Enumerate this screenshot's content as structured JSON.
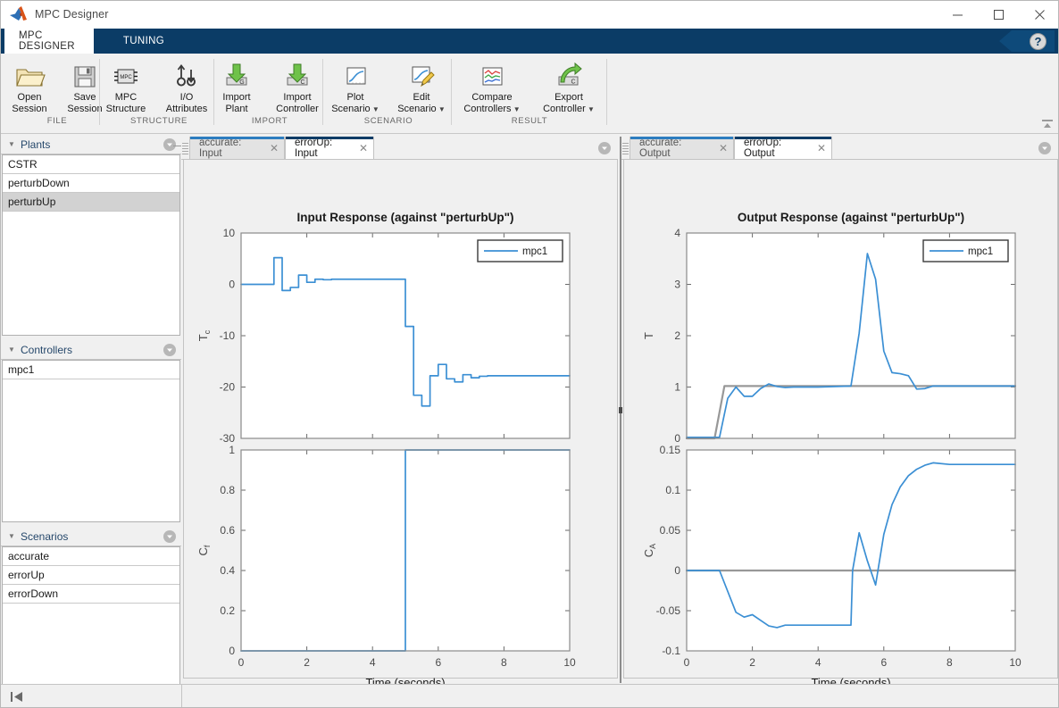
{
  "window": {
    "title": "MPC Designer",
    "minimize_label": "—",
    "maximize_label": "□",
    "close_label": "✕"
  },
  "ribbon": {
    "tabs": [
      {
        "label": "MPC DESIGNER",
        "active": true
      },
      {
        "label": "TUNING",
        "active": false
      }
    ],
    "help_label": "?",
    "collapse_label": "collapse-ribbon",
    "groups": [
      {
        "title": "FILE",
        "buttons": [
          {
            "label_line1": "Open",
            "label_line2": "Session",
            "icon": "folder-open-icon",
            "caret": false
          },
          {
            "label_line1": "Save",
            "label_line2": "Session",
            "icon": "floppy-disk-icon",
            "caret": false
          }
        ]
      },
      {
        "title": "STRUCTURE",
        "buttons": [
          {
            "label_line1": "MPC",
            "label_line2": "Structure",
            "icon": "mpc-chip-icon",
            "caret": false
          },
          {
            "label_line1": "I/O",
            "label_line2": "Attributes",
            "icon": "io-attributes-icon",
            "caret": false
          }
        ]
      },
      {
        "title": "IMPORT",
        "buttons": [
          {
            "label_line1": "Import",
            "label_line2": "Plant",
            "icon": "import-plant-icon",
            "caret": false
          },
          {
            "label_line1": "Import",
            "label_line2": "Controller",
            "icon": "import-controller-icon",
            "caret": false
          }
        ]
      },
      {
        "title": "SCENARIO",
        "buttons": [
          {
            "label_line1": "Plot",
            "label_line2": "Scenario",
            "icon": "plot-scenario-icon",
            "caret": true
          },
          {
            "label_line1": "Edit",
            "label_line2": "Scenario",
            "icon": "edit-scenario-icon",
            "caret": true
          }
        ]
      },
      {
        "title": "RESULT",
        "buttons": [
          {
            "label_line1": "Compare",
            "label_line2": "Controllers",
            "icon": "compare-controllers-icon",
            "caret": true
          },
          {
            "label_line1": "Export",
            "label_line2": "Controller",
            "icon": "export-controller-icon",
            "caret": true
          }
        ]
      }
    ]
  },
  "sidebar": {
    "sections": [
      {
        "title": "Plants",
        "items": [
          {
            "label": "CSTR",
            "selected": false
          },
          {
            "label": "perturbDown",
            "selected": false
          },
          {
            "label": "perturbUp",
            "selected": true
          }
        ]
      },
      {
        "title": "Controllers",
        "items": [
          {
            "label": "mpc1",
            "selected": false
          }
        ]
      },
      {
        "title": "Scenarios",
        "items": [
          {
            "label": "accurate",
            "selected": false
          },
          {
            "label": "errorUp",
            "selected": false
          },
          {
            "label": "errorDown",
            "selected": false
          }
        ]
      }
    ]
  },
  "document_groups": [
    {
      "name": "input-group",
      "tabs": [
        {
          "label": "accurate: Input",
          "active": false,
          "close_label": "✕"
        },
        {
          "label": "errorUp: Input",
          "active": true,
          "close_label": "✕"
        }
      ]
    },
    {
      "name": "output-group",
      "tabs": [
        {
          "label": "accurate: Output",
          "active": false,
          "close_label": "✕"
        },
        {
          "label": "errorUp: Output",
          "active": true,
          "close_label": "✕"
        }
      ]
    }
  ],
  "statusbar": {
    "collapse_label": "collapse-left-panel"
  },
  "colors": {
    "accent_blue": "#0b3c66",
    "tab_blue": "#2d7dbf",
    "line_blue": "#3b8fd4",
    "reference_gray": "#989898",
    "panel_gray": "#f0f0f0",
    "selection_gray": "#d2d2d2"
  },
  "chart_data": [
    {
      "type": "line",
      "name": "input-response-Tc",
      "title": "Input Response (against \"perturbUp\")",
      "xlabel": "Time (seconds)",
      "ylabel": "T_c",
      "xlim": [
        0,
        10
      ],
      "ylim": [
        -30,
        10
      ],
      "xticks": [
        0,
        2,
        4,
        6,
        8,
        10
      ],
      "yticks": [
        -30,
        -20,
        -10,
        0,
        10
      ],
      "grid": false,
      "legend": [
        "mpc1"
      ],
      "legend_position": "top-right",
      "style": "stairs",
      "series": [
        {
          "name": "mpc1",
          "color": "#3b8fd4",
          "x": [
            0,
            1.0,
            1.0,
            1.25,
            1.25,
            1.5,
            1.5,
            1.75,
            1.75,
            2.0,
            2.0,
            2.25,
            2.25,
            2.5,
            2.5,
            2.75,
            2.75,
            3.0,
            3.0,
            3.25,
            3.25,
            3.5,
            3.5,
            5.0,
            5.0,
            5.25,
            5.25,
            5.5,
            5.5,
            5.75,
            5.75,
            6.0,
            6.0,
            6.25,
            6.25,
            6.5,
            6.5,
            6.75,
            6.75,
            7.0,
            7.0,
            7.25,
            7.25,
            7.5,
            7.5,
            10.0
          ],
          "y": [
            0,
            0,
            5.2,
            5.2,
            -1.2,
            -1.2,
            -0.6,
            -0.6,
            1.8,
            1.8,
            0.4,
            0.4,
            1.0,
            1.0,
            0.9,
            0.9,
            1.0,
            1.0,
            1.0,
            1.0,
            1.0,
            1.0,
            1.0,
            1.0,
            -8.2,
            -8.2,
            -21.6,
            -21.6,
            -23.7,
            -23.7,
            -17.8,
            -17.8,
            -15.6,
            -15.6,
            -18.4,
            -18.4,
            -19.0,
            -19.0,
            -17.6,
            -17.6,
            -18.2,
            -18.2,
            -17.9,
            -17.9,
            -17.8,
            -17.8
          ]
        }
      ]
    },
    {
      "type": "line",
      "name": "input-response-Cf",
      "title": "",
      "xlabel": "Time (seconds)",
      "ylabel": "C_f",
      "xlim": [
        0,
        10
      ],
      "ylim": [
        0,
        1
      ],
      "xticks": [
        0,
        2,
        4,
        6,
        8,
        10
      ],
      "yticks": [
        0,
        0.2,
        0.4,
        0.6,
        0.8,
        1
      ],
      "grid": false,
      "legend": [],
      "style": "stairs",
      "series": [
        {
          "name": "mpc1",
          "color": "#3b8fd4",
          "x": [
            0,
            5.0,
            5.0,
            10.0
          ],
          "y": [
            0,
            0,
            1.0,
            1.0
          ]
        }
      ]
    },
    {
      "type": "line",
      "name": "output-response-T",
      "title": "Output Response (against \"perturbUp\")",
      "xlabel": "Time (seconds)",
      "ylabel": "T",
      "xlim": [
        0,
        10
      ],
      "ylim": [
        0,
        4
      ],
      "xticks": [
        0,
        2,
        4,
        6,
        8,
        10
      ],
      "yticks": [
        0,
        1,
        2,
        3,
        4
      ],
      "grid": false,
      "legend": [
        "mpc1"
      ],
      "legend_position": "top-right",
      "series": [
        {
          "name": "reference",
          "color": "#989898",
          "x": [
            0,
            0.85,
            1.15,
            10.0
          ],
          "y": [
            0,
            0,
            1.02,
            1.02
          ]
        },
        {
          "name": "mpc1",
          "color": "#3b8fd4",
          "x": [
            0,
            1.0,
            1.25,
            1.5,
            1.75,
            2.0,
            2.25,
            2.5,
            2.75,
            3.0,
            3.25,
            3.5,
            3.75,
            4.0,
            5.0,
            5.25,
            5.5,
            5.75,
            6.0,
            6.25,
            6.5,
            6.75,
            7.0,
            7.25,
            7.5,
            8.0,
            9.0,
            10.0
          ],
          "y": [
            0.02,
            0.02,
            0.78,
            1.0,
            0.82,
            0.82,
            0.97,
            1.06,
            1.01,
            0.99,
            1.0,
            1.0,
            1.0,
            1.0,
            1.02,
            2.05,
            3.6,
            3.1,
            1.7,
            1.28,
            1.26,
            1.22,
            0.96,
            0.97,
            1.02,
            1.02,
            1.02,
            1.02
          ]
        }
      ]
    },
    {
      "type": "line",
      "name": "output-response-CA",
      "title": "",
      "xlabel": "Time (seconds)",
      "ylabel": "C_A",
      "xlim": [
        0,
        10
      ],
      "ylim": [
        -0.1,
        0.15
      ],
      "xticks": [
        0,
        2,
        4,
        6,
        8,
        10
      ],
      "yticks": [
        -0.1,
        -0.05,
        0,
        0.05,
        0.1,
        0.15
      ],
      "grid": false,
      "legend": [],
      "series": [
        {
          "name": "reference",
          "color": "#989898",
          "x": [
            0,
            10.0
          ],
          "y": [
            0,
            0
          ]
        },
        {
          "name": "mpc1",
          "color": "#3b8fd4",
          "x": [
            0,
            1.0,
            1.5,
            1.75,
            2.0,
            2.25,
            2.5,
            2.75,
            3.0,
            3.5,
            4.0,
            4.5,
            5.0,
            5.05,
            5.25,
            5.5,
            5.75,
            6.0,
            6.25,
            6.5,
            6.75,
            7.0,
            7.25,
            7.5,
            8.0,
            9.0,
            10.0
          ],
          "y": [
            0,
            0,
            -0.052,
            -0.058,
            -0.055,
            -0.062,
            -0.069,
            -0.071,
            -0.068,
            -0.068,
            -0.068,
            -0.068,
            -0.068,
            0.0,
            0.047,
            0.012,
            -0.018,
            0.045,
            0.082,
            0.104,
            0.118,
            0.126,
            0.131,
            0.134,
            0.132,
            0.132,
            0.132
          ]
        }
      ]
    }
  ]
}
